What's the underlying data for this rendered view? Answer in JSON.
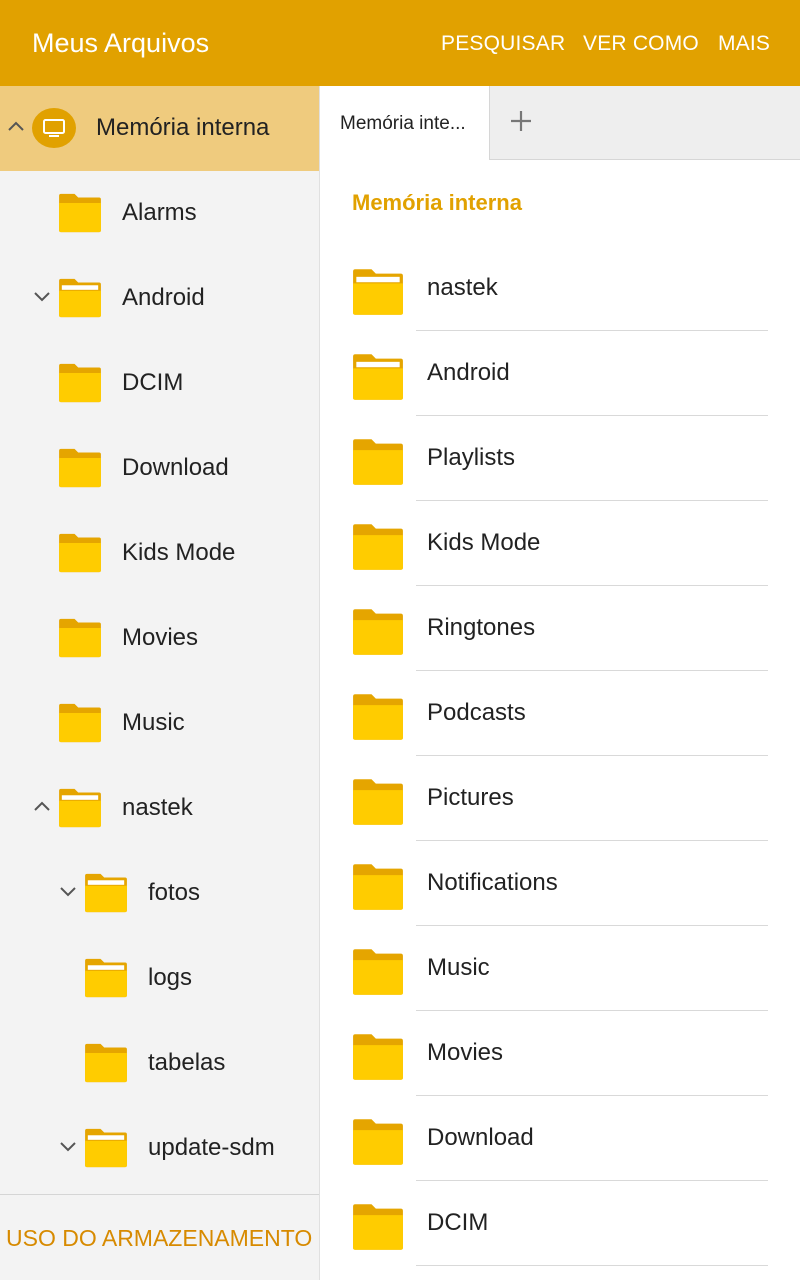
{
  "app_bar": {
    "title": "Meus Arquivos",
    "actions": [
      "PESQUISAR",
      "VER COMO",
      "MAIS"
    ]
  },
  "colors": {
    "accent": "#E1A100",
    "folder": "#FFCC00",
    "selected_row": "#EFCB7E",
    "storage_link": "#D78A00"
  },
  "sidebar": {
    "root": {
      "label": "Memória interna",
      "icon": "device-icon",
      "expanded": true
    },
    "items": [
      {
        "label": "Alarms",
        "depth": 1,
        "chevron": "none",
        "icon": "folder-icon"
      },
      {
        "label": "Android",
        "depth": 1,
        "chevron": "down",
        "icon": "folder-open-icon"
      },
      {
        "label": "DCIM",
        "depth": 1,
        "chevron": "none",
        "icon": "folder-icon"
      },
      {
        "label": "Download",
        "depth": 1,
        "chevron": "none",
        "icon": "folder-icon"
      },
      {
        "label": "Kids Mode",
        "depth": 1,
        "chevron": "none",
        "icon": "folder-icon"
      },
      {
        "label": "Movies",
        "depth": 1,
        "chevron": "none",
        "icon": "folder-icon"
      },
      {
        "label": "Music",
        "depth": 1,
        "chevron": "none",
        "icon": "folder-icon"
      },
      {
        "label": "nastek",
        "depth": 1,
        "chevron": "up",
        "icon": "folder-open-icon"
      },
      {
        "label": "fotos",
        "depth": 2,
        "chevron": "down",
        "icon": "folder-open-icon"
      },
      {
        "label": "logs",
        "depth": 2,
        "chevron": "none",
        "icon": "folder-open-icon"
      },
      {
        "label": "tabelas",
        "depth": 2,
        "chevron": "none",
        "icon": "folder-icon"
      },
      {
        "label": "update-sdm",
        "depth": 2,
        "chevron": "down",
        "icon": "folder-open-icon"
      }
    ],
    "footer_label": "USO DO ARMAZENAMENTO"
  },
  "tabs": {
    "items": [
      {
        "label": "Memória inte..."
      }
    ],
    "add_icon": "plus-icon"
  },
  "content": {
    "location_title": "Memória interna",
    "folders": [
      {
        "name": "nastek",
        "icon": "folder-open-icon"
      },
      {
        "name": "Android",
        "icon": "folder-open-icon"
      },
      {
        "name": "Playlists",
        "icon": "folder-icon"
      },
      {
        "name": "Kids Mode",
        "icon": "folder-icon"
      },
      {
        "name": "Ringtones",
        "icon": "folder-icon"
      },
      {
        "name": "Podcasts",
        "icon": "folder-icon"
      },
      {
        "name": "Pictures",
        "icon": "folder-icon"
      },
      {
        "name": "Notifications",
        "icon": "folder-icon"
      },
      {
        "name": "Music",
        "icon": "folder-icon"
      },
      {
        "name": "Movies",
        "icon": "folder-icon"
      },
      {
        "name": "Download",
        "icon": "folder-icon"
      },
      {
        "name": "DCIM",
        "icon": "folder-icon"
      }
    ]
  }
}
